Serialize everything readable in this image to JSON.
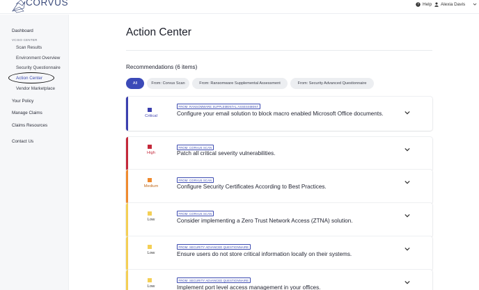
{
  "header": {
    "logo_text": "CORVUS",
    "help_label": "Help",
    "user_name": "Alexia Davis"
  },
  "sidebar": {
    "dashboard": "Dashboard",
    "section_label": "VCISO CENTER",
    "scan_results": "Scan Results",
    "environment_overview": "Environment Overview",
    "security_questionnaire": "Security Questionnaire",
    "action_center": "Action Center",
    "vendor_marketplace": "Vendor Marketplace",
    "your_policy": "Your Policy",
    "manage_claims": "Manage Claims",
    "claims_resources": "Claims Resources",
    "contact_us": "Contact Us"
  },
  "main": {
    "title": "Action Center",
    "recommendations_title": "Recommendations (6 items)",
    "filters": [
      "All",
      "From: Corvus Scan",
      "From: Ransomware Supplemental Assessment",
      "From: Security Advanced Questionnaire"
    ],
    "cards": [
      {
        "severity": "Critical",
        "color": "#3b3fae",
        "source": "FROM: RANSOMWARE SUPPLEMENTAL ASSESSMENT",
        "text": "Configure your email solution to block macro enabled Microsoft Office documents."
      },
      {
        "severity": "High",
        "color": "#c4283a",
        "source": "FROM: CORVUS SCAN",
        "text": "Patch all critical severity vulnerabilities."
      },
      {
        "severity": "Medium",
        "color": "#ef8a2e",
        "source": "FROM: CORVUS SCAN",
        "text": "Configure Security Certificates According to Best Practices."
      },
      {
        "severity": "Low",
        "color": "#f4cf55",
        "source": "FROM: CORVUS SCAN",
        "text": "Consider implementing a Zero Trust Network Access (ZTNA) solution."
      },
      {
        "severity": "Low",
        "color": "#f4cf55",
        "source": "FROM: SECURITY ADVANCED QUESTIONNAIRE",
        "text": "Ensure users do not store critical information locally on their systems."
      },
      {
        "severity": "Low",
        "color": "#f4cf55",
        "source": "FROM: SECURITY ADVANCED QUESTIONNAIRE",
        "text": "Implement port level access management in your offices."
      }
    ]
  }
}
